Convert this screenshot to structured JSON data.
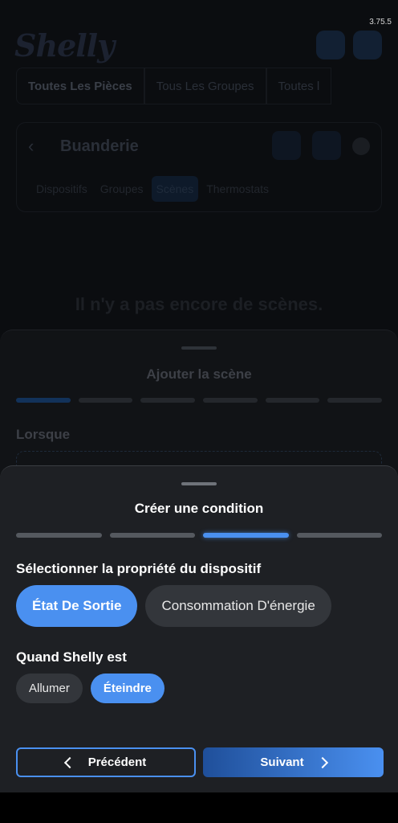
{
  "status": {
    "version": "3.75.5"
  },
  "background": {
    "logo": "Shelly",
    "room_tabs": [
      "Toutes Les Pièces",
      "Tous Les Groupes",
      "Toutes l"
    ],
    "room": {
      "name": "Buanderie",
      "sub_tabs": [
        "Dispositifs",
        "Groupes",
        "Scènes",
        "Thermostats"
      ],
      "active_sub_tab": "Scènes"
    },
    "empty_message": "Il n'y a pas encore de scènes."
  },
  "scene_sheet": {
    "title": "Ajouter la scène",
    "step_count": 6,
    "active_step": 1,
    "section_label": "Lorsque"
  },
  "condition_sheet": {
    "title": "Créer une condition",
    "step_count": 4,
    "active_step": 3,
    "property_label": "Sélectionner la propriété du dispositif",
    "property_options": [
      "État De Sortie",
      "Consommation D'énergie"
    ],
    "property_selected": "État De Sortie",
    "when_label": "Quand Shelly est",
    "when_options": [
      "Allumer",
      "Éteindre"
    ],
    "when_selected": "Éteindre",
    "prev_label": "Précédent",
    "next_label": "Suivant"
  },
  "colors": {
    "accent": "#4a90f0",
    "sheet_bg": "#1e2024",
    "chip_unselected": "#33363b"
  },
  "icons": {
    "back": "chevron-left-icon",
    "next": "chevron-right-icon"
  }
}
